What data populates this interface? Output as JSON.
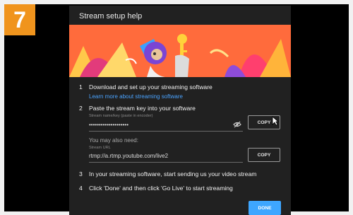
{
  "step_number": "7",
  "dialog": {
    "title": "Stream setup help",
    "steps": [
      {
        "num": "1",
        "text": "Download and set up your streaming software"
      },
      {
        "num": "2",
        "text": "Paste the stream key into your software"
      },
      {
        "num": "3",
        "text": "In your streaming software, start sending us your video stream"
      },
      {
        "num": "4",
        "text": "Click 'Done' and then click 'Go Live' to start streaming"
      }
    ],
    "learn_more_link": "Learn more about streaming software",
    "stream_key": {
      "label": "Stream name/key (paste in encoder)",
      "value": "••••••••••••••••••••",
      "copy_label": "COPY"
    },
    "also_need": "You may also need:",
    "stream_url": {
      "label": "Stream URL",
      "value": "rtmp://a.rtmp.youtube.com/live2",
      "copy_label": "COPY"
    },
    "done_label": "DONE"
  },
  "colors": {
    "badge": "#f0941d",
    "dialog_bg": "#212121",
    "link": "#4aa3ff",
    "done_button": "#3ea6ff"
  },
  "icons": [
    "eye-off-icon",
    "mouse-cursor-icon"
  ]
}
